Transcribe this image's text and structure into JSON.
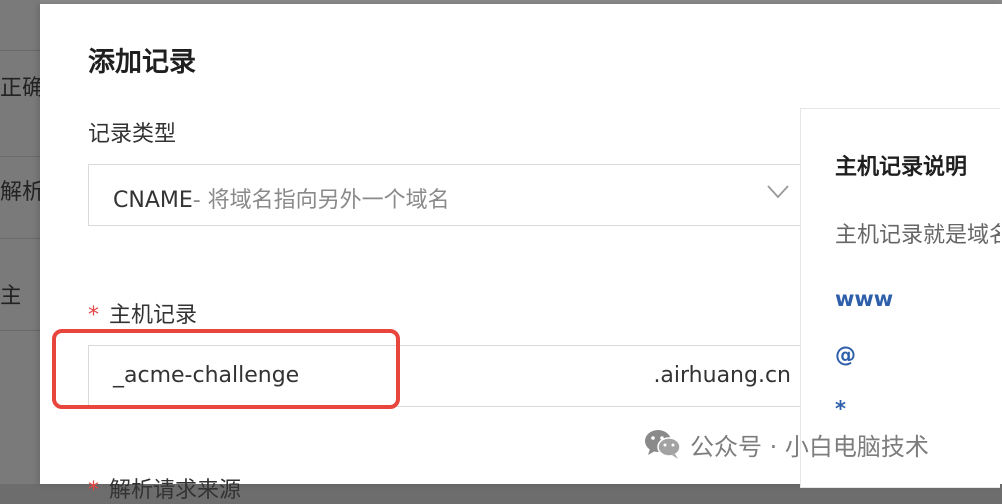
{
  "background": {
    "row_fragments": [
      "正确",
      "解析",
      "主"
    ]
  },
  "dialog": {
    "title": "添加记录",
    "record_type": {
      "label": "记录类型",
      "selected_value": "CNAME",
      "selected_desc": "- 将域名指向另外一个域名"
    },
    "host_record": {
      "required_mark": "*",
      "label": "主机记录",
      "value": "_acme-challenge",
      "suffix": ".airhuang.cn"
    },
    "next_field": {
      "required_mark": "*",
      "label": "解析请求来源"
    }
  },
  "help_panel": {
    "title": "主机记录说明",
    "description": "主机记录就是域名前缀",
    "examples": [
      "www",
      "@",
      "*"
    ]
  },
  "watermark": {
    "text": "公众号 · 小白电脑技术",
    "icon": "wechat-icon"
  },
  "colors": {
    "highlight": "#e8453c",
    "required": "#e54545",
    "example_link": "#2e5faa"
  }
}
